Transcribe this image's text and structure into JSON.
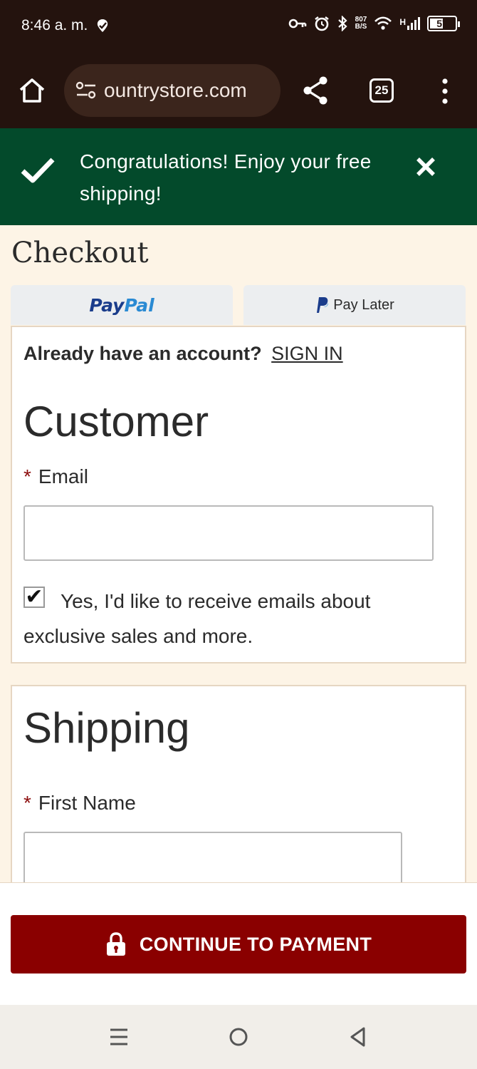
{
  "status_bar": {
    "time": "8:46 a. m.",
    "net_speed_value": "807",
    "net_speed_unit": "B/S",
    "signal_label": "H",
    "battery_level": 57,
    "battery_text": "57",
    "icons": [
      "location-check-icon",
      "key-icon",
      "alarm-icon",
      "bluetooth-icon",
      "wifi-icon",
      "signal-icon",
      "battery-icon"
    ]
  },
  "browser": {
    "url": "ountrystore.com",
    "tab_count": "25",
    "icons": [
      "home-icon",
      "site-settings-icon",
      "share-icon",
      "tabs-icon",
      "more-vert-icon"
    ]
  },
  "banner": {
    "message": "Congratulations! Enjoy your free shipping!",
    "background": "#034a2b"
  },
  "checkout": {
    "title": "Checkout",
    "paypal_label_a": "Pay",
    "paypal_label_b": "Pal",
    "pay_later_label": "Pay Later",
    "account_prompt": "Already have an account?",
    "sign_in_label": "SIGN IN",
    "customer": {
      "section_title": "Customer",
      "required_mark": "*",
      "email_label": "Email",
      "email_value": "",
      "optin_checked": true,
      "optin_text": "Yes, I'd like to receive emails about exclusive sales and more."
    },
    "shipping": {
      "section_title": "Shipping",
      "required_mark": "*",
      "first_name_label": "First Name",
      "first_name_value": ""
    },
    "continue_label": "CONTINUE TO PAYMENT",
    "accent_color": "#8a0000"
  },
  "nav_bar": {
    "icons": [
      "recents-icon",
      "home-circle-icon",
      "back-icon"
    ]
  }
}
